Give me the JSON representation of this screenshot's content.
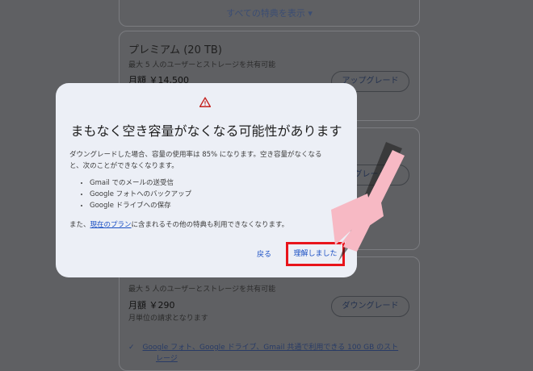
{
  "background": {
    "show_all_label": "すべての特典を表示 ▾",
    "premium": {
      "title": "プレミアム (20 TB)",
      "description": "最大 5 人のユーザーとストレージを共有可能",
      "price": "月額 ￥14,500",
      "button": "アップグレード"
    },
    "mid_button_fragment": "グレード",
    "basic": {
      "description": "最大 5 人のユーザーとストレージを共有可能",
      "price": "月額 ￥290",
      "billing": "月単位の請求となります",
      "button": "ダウングレード",
      "feature": "Google フォト、Google ドライブ、Gmail 共通で利用できる 100 GB のスト",
      "feature_cont": "レージ"
    }
  },
  "dialog": {
    "icon": "warning-icon",
    "title": "まもなく空き容量がなくなる可能性があります",
    "body_line1": "ダウングレードした場合、容量の使用率は 85% になります。空き容量がなくなる",
    "body_line2": "と、次のことができなくなります。",
    "items": [
      "Gmail でのメールの送受信",
      "Google フォトへのバックアップ",
      "Google ドライブへの保存"
    ],
    "footer_prefix": "また、",
    "footer_link": "現在のプラン",
    "footer_suffix": "に含まれるその他の特典も利用できなくなります。",
    "back_button": "戻る",
    "ok_button": "理解しました"
  },
  "colors": {
    "highlight": "#e8141b",
    "arrow": "#f7b9c4",
    "link": "#1a4fc4"
  }
}
